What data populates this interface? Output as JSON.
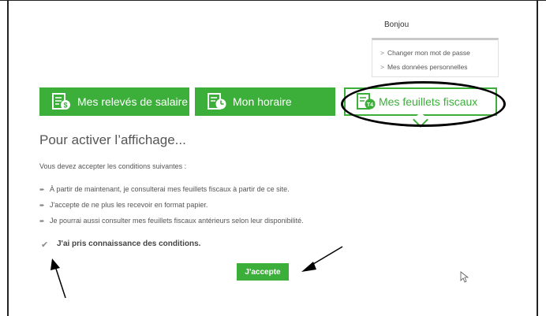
{
  "header": {
    "greeting": "Bonjou",
    "user_menu": [
      {
        "label": "Changer mon mot de passe"
      },
      {
        "label": "Mes données personnelles"
      }
    ]
  },
  "tabs": [
    {
      "label": "Mes relevés de salaire",
      "icon": "pay-stub-icon",
      "active": false
    },
    {
      "label": "Mon horaire",
      "icon": "schedule-clock-icon",
      "active": false
    },
    {
      "label": "Mes feuillets fiscaux",
      "icon": "tax-slip-icon",
      "active": true
    }
  ],
  "content": {
    "heading": "Pour activer l’affichage...",
    "intro": "Vous devez accepter les conditions suivantes :",
    "conditions": [
      "À partir de maintenant, je consulterai mes feuillets fiscaux à partir de ce site.",
      "J'accepte de ne plus les recevoir en format papier.",
      "Je pourrai aussi consulter mes feuillets fiscaux antérieurs selon leur disponibilité."
    ],
    "checkbox_label": "J'ai pris connaissance des conditions.",
    "checkbox_checked": true,
    "accept_button": "J'accepte"
  },
  "colors": {
    "brand_green": "#3cae3a"
  }
}
